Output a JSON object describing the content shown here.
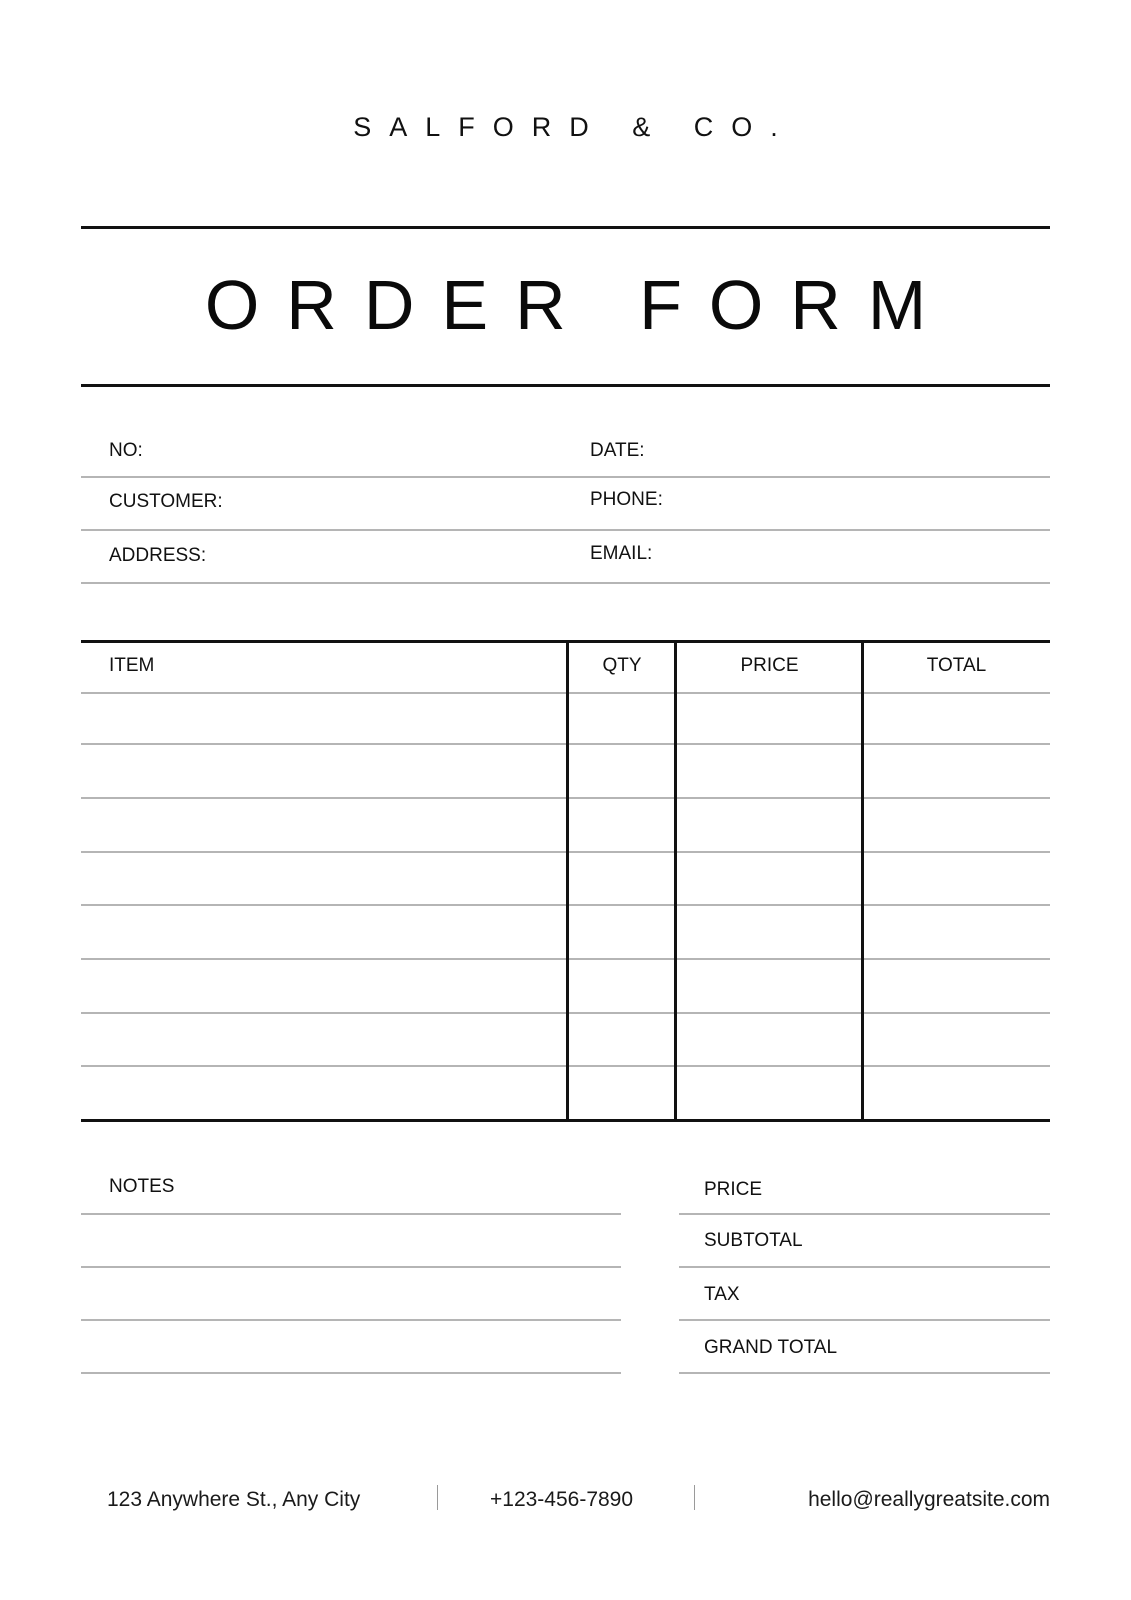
{
  "header": {
    "company": "SALFORD & CO.",
    "title": "ORDER FORM"
  },
  "info": {
    "left": [
      {
        "label": "NO:",
        "value": ""
      },
      {
        "label": "CUSTOMER:",
        "value": ""
      },
      {
        "label": "ADDRESS:",
        "value": ""
      }
    ],
    "right": [
      {
        "label": "DATE:",
        "value": ""
      },
      {
        "label": "PHONE:",
        "value": ""
      },
      {
        "label": "EMAIL:",
        "value": ""
      }
    ]
  },
  "table": {
    "columns": [
      "ITEM",
      "QTY",
      "PRICE",
      "TOTAL"
    ],
    "rows": [
      [
        "",
        "",
        "",
        ""
      ],
      [
        "",
        "",
        "",
        ""
      ],
      [
        "",
        "",
        "",
        ""
      ],
      [
        "",
        "",
        "",
        ""
      ],
      [
        "",
        "",
        "",
        ""
      ],
      [
        "",
        "",
        "",
        ""
      ],
      [
        "",
        "",
        "",
        ""
      ],
      [
        "",
        "",
        "",
        ""
      ]
    ]
  },
  "notes": {
    "label": "NOTES",
    "lines": [
      "",
      "",
      ""
    ]
  },
  "summary": [
    {
      "label": "PRICE",
      "value": ""
    },
    {
      "label": "SUBTOTAL",
      "value": ""
    },
    {
      "label": "TAX",
      "value": ""
    },
    {
      "label": "GRAND TOTAL",
      "value": ""
    }
  ],
  "footer": {
    "address": "123 Anywhere St., Any City",
    "phone": "+123-456-7890",
    "email": "hello@reallygreatsite.com"
  }
}
